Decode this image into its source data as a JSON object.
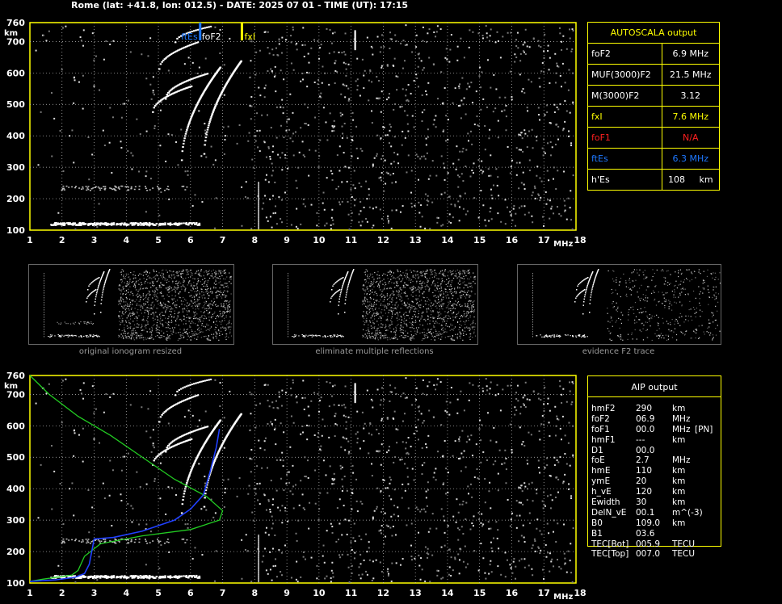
{
  "header": {
    "title": "Rome (lat: +41.8, lon: 012.5) - DATE: 2025 07 01 - TIME (UT): 17:15"
  },
  "axes": {
    "y_unit": "km",
    "x_unit": "MHz",
    "y_ticks": [
      "760",
      "700",
      "600",
      "500",
      "400",
      "300",
      "200",
      "100"
    ],
    "x_ticks": [
      "1",
      "2",
      "3",
      "4",
      "5",
      "6",
      "7",
      "8",
      "9",
      "10",
      "11",
      "12",
      "13",
      "14",
      "15",
      "16",
      "17",
      "18"
    ]
  },
  "markers": {
    "ftEs": "ftEs",
    "foF2": "foF2",
    "fxI": "fxI"
  },
  "autoscala": {
    "title": "AUTOSCALA output",
    "rows": [
      {
        "label": "foF2",
        "value": "6.9 MHz",
        "color": "#ffffff"
      },
      {
        "label": "MUF(3000)F2",
        "value": "21.5 MHz",
        "color": "#ffffff"
      },
      {
        "label": "M(3000)F2",
        "value": "3.12",
        "color": "#ffffff"
      },
      {
        "label": "fxI",
        "value": "7.6 MHz",
        "color": "#ffff00"
      },
      {
        "label": "foF1",
        "value": "N/A",
        "color": "#ff2020"
      },
      {
        "label": "ftEs",
        "value": "6.3 MHz",
        "color": "#1e78ff"
      },
      {
        "label": "h'Es",
        "value": "108     km",
        "color": "#ffffff"
      }
    ]
  },
  "thumbnails": [
    {
      "caption": "original ionogram resized"
    },
    {
      "caption": "eliminate multiple reflections"
    },
    {
      "caption": "evidence F2 trace"
    }
  ],
  "aip": {
    "title": "AIP output",
    "rows": [
      {
        "name": "hmF2",
        "value": "290",
        "unit": "km",
        "extra": ""
      },
      {
        "name": "foF2",
        "value": "06.9",
        "unit": "MHz",
        "extra": ""
      },
      {
        "name": "foF1",
        "value": "00.0",
        "unit": "MHz",
        "extra": "[PN]"
      },
      {
        "name": "hmF1",
        "value": "---",
        "unit": "km",
        "extra": ""
      },
      {
        "name": "D1",
        "value": "00.0",
        "unit": "",
        "extra": ""
      },
      {
        "name": "foE",
        "value": "2.7",
        "unit": "MHz",
        "extra": ""
      },
      {
        "name": "hmE",
        "value": "110",
        "unit": "km",
        "extra": ""
      },
      {
        "name": "ymE",
        "value": "20",
        "unit": "km",
        "extra": ""
      },
      {
        "name": "h_vE",
        "value": "120",
        "unit": "km",
        "extra": ""
      },
      {
        "name": "Ewidth",
        "value": "30",
        "unit": "km",
        "extra": ""
      },
      {
        "name": "DelN_vE",
        "value": "00.1",
        "unit": "m^(-3)",
        "extra": ""
      },
      {
        "name": "B0",
        "value": "109.0",
        "unit": "km",
        "extra": ""
      },
      {
        "name": "B1",
        "value": "03.6",
        "unit": "",
        "extra": ""
      },
      {
        "name": "TEC[Bot]",
        "value": "005.9",
        "unit": "TECU",
        "extra": ""
      },
      {
        "name": "TEC[Top]",
        "value": "007.0",
        "unit": "TECU",
        "extra": ""
      }
    ]
  },
  "colors": {
    "frame": "#ffff00",
    "grid": "#c8c8c8",
    "profile": "#22cc22",
    "trace": "#2040ff",
    "es_marker": "#1e78ff"
  }
}
